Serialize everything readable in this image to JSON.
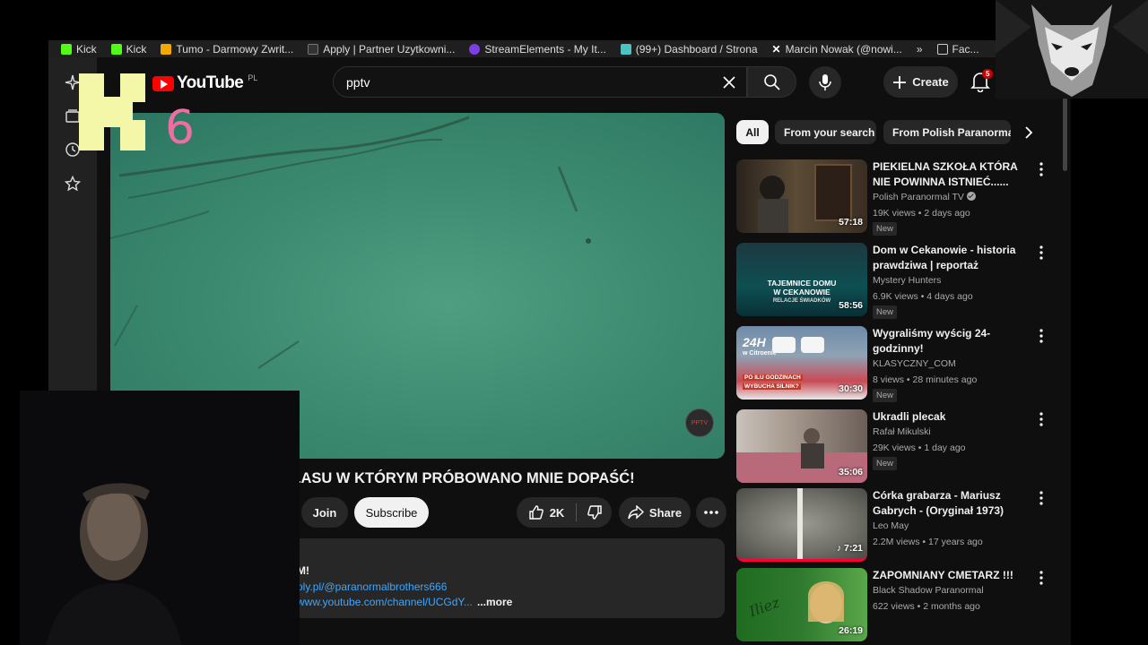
{
  "bookmarks": [
    {
      "label": "Kick",
      "color": "#53fc18"
    },
    {
      "label": "Kick",
      "color": "#53fc18"
    },
    {
      "label": "Tumo - Darmowy Zwrit...",
      "color": "#f2a900"
    },
    {
      "label": "Apply | Partner Uzytkowni...",
      "color": "#333333"
    },
    {
      "label": "StreamElements - My It...",
      "color": "#7b3fe4"
    },
    {
      "label": "(99+) Dashboard / Strona",
      "color": "#4fc3c3"
    },
    {
      "label": "Marcin Nowak (@nowi...",
      "color": "#000000"
    },
    {
      "label": "»",
      "color": ""
    },
    {
      "label": "Fac...",
      "color": "#cccccc"
    }
  ],
  "header": {
    "logo_text": "YouTube",
    "country_code": "PL",
    "search_value": "pptv",
    "create_label": "Create",
    "notification_count": "5"
  },
  "overlay": {
    "stream_logo_digit": "6"
  },
  "video": {
    "title_visible": "O LASU W KTÓRYM PRÓBOWANO MNIE DOPAŚĆ!",
    "watermark_text": "PPTV"
  },
  "actions": {
    "join": "Join",
    "subscribe": "Subscribe",
    "likes": "2K",
    "share": "Share"
  },
  "description": {
    "line1": "M!",
    "line2": "oly.pl/@paranormalbrothers666",
    "line3": "www.youtube.com/channel/UCGdY...",
    "more": "...more"
  },
  "chips": [
    {
      "label": "All",
      "selected": true
    },
    {
      "label": "From your search",
      "selected": false
    },
    {
      "label": "From Polish Paranormal",
      "selected": false
    }
  ],
  "recommendations": [
    {
      "title": "PIEKIELNA SZKOŁA KTÓRA NIE POWINNA ISTNIEĆ......",
      "channel": "Polish Paranormal TV",
      "verified": true,
      "views": "19K views",
      "age": "2 days ago",
      "badge": "New",
      "duration": "57:18",
      "thumb_color": "#3a2e22"
    },
    {
      "title": "Dom w Cekanowie - historia prawdziwa | reportaż",
      "channel": "Mystery Hunters",
      "verified": false,
      "views": "6.9K views",
      "age": "4 days ago",
      "badge": "New",
      "duration": "58:56",
      "thumb_color": "#0e4f52",
      "thumb_text": [
        "TAJEMNICE DOMU",
        "W CEKANOWIE",
        "RELACJE ŚWIADKÓW"
      ]
    },
    {
      "title": "Wygraliśmy wyścig 24-godzinny!",
      "channel": "KLASYCZNY_COM",
      "verified": false,
      "views": "8 views",
      "age": "28 minutes ago",
      "badge": "New",
      "duration": "30:30",
      "thumb_color": "#6f8aa8",
      "thumb_text": [
        "24H",
        "w Citroenie",
        "PO ILU GODZINACH",
        "WYBUCHA SILNIK?"
      ]
    },
    {
      "title": "Ukradli plecak",
      "channel": "Rafał Mikulski",
      "verified": false,
      "views": "29K views",
      "age": "1 day ago",
      "badge": "New",
      "duration": "35:06",
      "thumb_color": "#a79a8f"
    },
    {
      "title": "Córka grabarza - Mariusz Gabrych - (Oryginał 1973)",
      "channel": "Leo May",
      "verified": false,
      "views": "2.2M views",
      "age": "17 years ago",
      "badge": "",
      "duration": "7:21",
      "thumb_color": "#6d6d66"
    },
    {
      "title": "ZAPOMNIANY CMETARZ !!!",
      "channel": "Black Shadow Paranormal",
      "verified": false,
      "views": "622 views",
      "age": "2 months ago",
      "badge": "",
      "duration": "26:19",
      "thumb_color": "#2f7a2f",
      "thumb_text": [
        "Iliez"
      ]
    }
  ]
}
